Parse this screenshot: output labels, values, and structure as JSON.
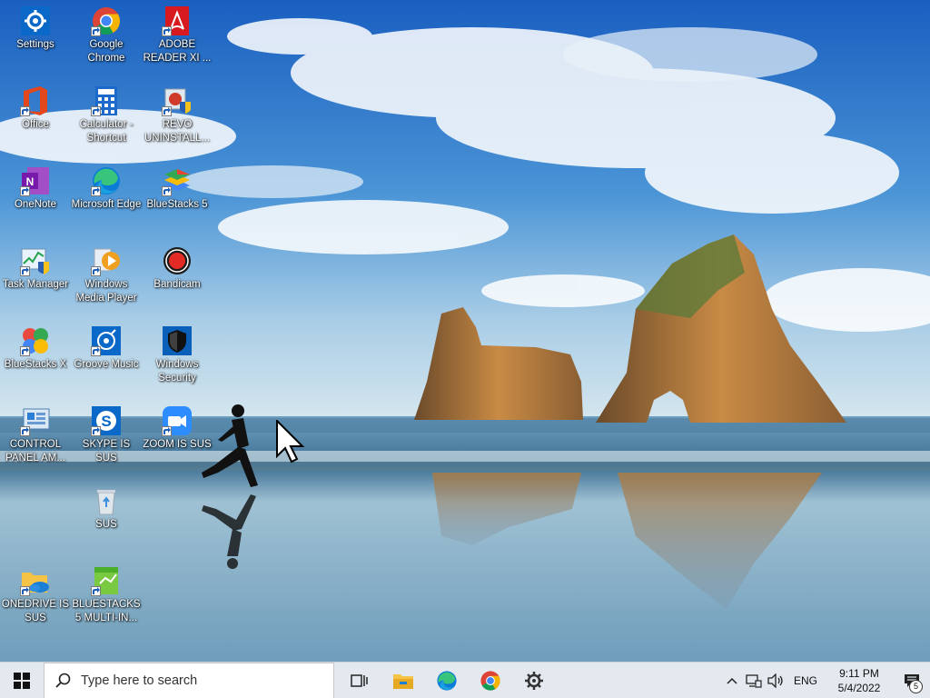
{
  "desktop": {
    "icons": [
      {
        "label": "Settings"
      },
      {
        "label": "Google Chrome"
      },
      {
        "label": "ADOBE READER XI ..."
      },
      {
        "label": "Office"
      },
      {
        "label": "Calculator - Shortcut"
      },
      {
        "label": "REVO UNINSTALL..."
      },
      {
        "label": "OneNote"
      },
      {
        "label": "Microsoft Edge"
      },
      {
        "label": "BlueStacks 5"
      },
      {
        "label": "Task Manager"
      },
      {
        "label": "Windows Media Player"
      },
      {
        "label": "Bandicam"
      },
      {
        "label": "BlueStacks X"
      },
      {
        "label": "Groove Music"
      },
      {
        "label": "Windows Security"
      },
      {
        "label": "CONTROL PANEL AM..."
      },
      {
        "label": "SKYPE IS SUS"
      },
      {
        "label": "ZOOM IS SUS"
      },
      {
        "label": "SUS"
      },
      {
        "label": "ONEDRIVE IS SUS"
      },
      {
        "label": "BLUESTACKS 5 MULTI-IN..."
      }
    ]
  },
  "taskbar": {
    "search_placeholder": "Type here to search",
    "apps": [
      "task-view",
      "file-explorer",
      "microsoft-edge",
      "google-chrome",
      "settings"
    ],
    "tray": {
      "language": "ENG",
      "time": "9:11 PM",
      "date": "5/4/2022",
      "notification_count": "5"
    }
  },
  "colors": {
    "taskbar_bg": "#e4e9ef",
    "sky_top": "#1e66c4",
    "sea": "#5f8fae"
  }
}
